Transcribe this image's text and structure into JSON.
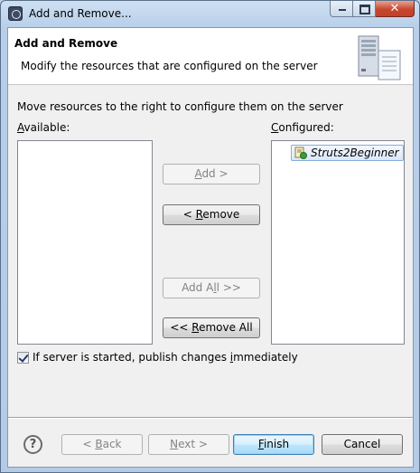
{
  "window": {
    "title": "Add and Remove..."
  },
  "banner": {
    "title": "Add and Remove",
    "description": "Modify the resources that are configured on the server",
    "image_icon": "server-icon"
  },
  "instructions": "Move resources to the right to configure them on the server",
  "available": {
    "label_mnemonic": "A",
    "label_rest": "vailable:",
    "items": []
  },
  "configured": {
    "label_mnemonic": "C",
    "label_rest": "onfigured:",
    "items": [
      {
        "label": "Struts2Beginner",
        "icon": "web-project-icon"
      }
    ]
  },
  "buttons": {
    "add": {
      "mn": "A",
      "rest": "dd >",
      "enabled": false
    },
    "remove": {
      "pre": "< ",
      "mn": "R",
      "rest": "emove",
      "enabled": true
    },
    "add_all": {
      "pre": "Add A",
      "mn": "l",
      "rest": "l >>",
      "enabled": false
    },
    "remove_all": {
      "pre": "<< ",
      "mn": "R",
      "rest": "emove All",
      "enabled": true
    },
    "back": {
      "pre": "< ",
      "mn": "B",
      "rest": "ack",
      "enabled": false
    },
    "next": {
      "pre": "",
      "mn": "N",
      "rest": "ext >",
      "enabled": false
    },
    "finish": {
      "pre": "",
      "mn": "F",
      "rest": "inish",
      "enabled": true
    },
    "cancel": {
      "label": "Cancel",
      "enabled": true
    }
  },
  "publish_option": {
    "checked": true,
    "pre": "If server is started, publish changes ",
    "mn": "i",
    "rest": "mmediately"
  },
  "help_icon": "?"
}
